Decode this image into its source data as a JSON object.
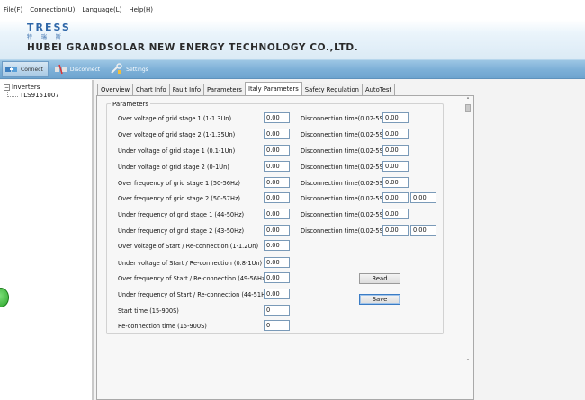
{
  "menu": {
    "file": "File(F)",
    "connection": "Connection(U)",
    "language": "Language(L)",
    "help": "Help(H)"
  },
  "banner": {
    "logo": "TRESS",
    "logo_sub": "特 瑞 斯",
    "company": "HUBEI GRANDSOLAR NEW ENERGY TECHNOLOGY CO.,LTD."
  },
  "toolbar": {
    "connect": "Connect",
    "disconnect": "Disconnect",
    "settings": "Settings"
  },
  "tree": {
    "root": "Inverters",
    "child": "TLS9151007",
    "expander": "−"
  },
  "tabs": [
    "Overview",
    "Chart Info",
    "Fault Info",
    "Parameters",
    "Italy Parameters",
    "Safety Regulation",
    "AutoTest"
  ],
  "group_title": "Parameters",
  "rows": [
    {
      "label": "Over voltage of grid stage 1 (1-1.3Un)",
      "value": "0.00",
      "disc_label": "Disconnection time(0.02-5S)",
      "disc_value": "0.00"
    },
    {
      "label": "Over voltage of grid stage 2 (1-1.35Un)",
      "value": "0.00",
      "disc_label": "Disconnection time(0.02-5S)",
      "disc_value": "0.00"
    },
    {
      "label": "Under voltage of grid stage 1 (0.1-1Un)",
      "value": "0.00",
      "disc_label": "Disconnection time(0.02-5S)",
      "disc_value": "0.00"
    },
    {
      "label": "Under voltage of grid stage 2 (0-1Un)",
      "value": "0.00",
      "disc_label": "Disconnection time(0.02-5S)",
      "disc_value": "0.00"
    },
    {
      "label": "Over frequency of grid stage 1 (50-56Hz)",
      "value": "0.00",
      "disc_label": "Disconnection time(0.02-5S)",
      "disc_value": "0.00"
    },
    {
      "label": "Over frequency of grid stage 2 (50-57Hz)",
      "value": "0.00",
      "disc_label": "Disconnection time(0.02-5S)",
      "disc_value": "0.00",
      "extra_value": "0.00"
    },
    {
      "label": "Under frequency of grid stage 1 (44-50Hz)",
      "value": "0.00",
      "disc_label": "Disconnection time(0.02-5S)",
      "disc_value": "0.00"
    },
    {
      "label": "Under frequency of grid stage 2 (43-50Hz)",
      "value": "0.00",
      "disc_label": "Disconnection time(0.02-5S)",
      "disc_value": "0.00",
      "extra_value": "0.00"
    },
    {
      "label": "Over voltage of Start / Re-connection (1-1.2Un)",
      "value": "0.00"
    },
    {
      "label": "Under voltage of Start / Re-connection (0.8-1Un)",
      "value": "0.00"
    },
    {
      "label": "Over frequency of Start / Re-connection (49-56Hz)",
      "value": "0.00"
    },
    {
      "label": "Under frequency of Start / Re-connection (44-51Hz)",
      "value": "0.00"
    },
    {
      "label": "Start time (15-900S)",
      "value": "0"
    },
    {
      "label": "Re-connection time (15-900S)",
      "value": "0"
    }
  ],
  "buttons": {
    "read": "Read",
    "save": "Save"
  },
  "scrollbar": {
    "up": "˄",
    "down": "˅"
  },
  "colors": {
    "toolbar": "#7eb1d8",
    "banner_text": "#2f67a8",
    "input_border": "#7a9ab8",
    "focus": "#3b7cc4"
  }
}
